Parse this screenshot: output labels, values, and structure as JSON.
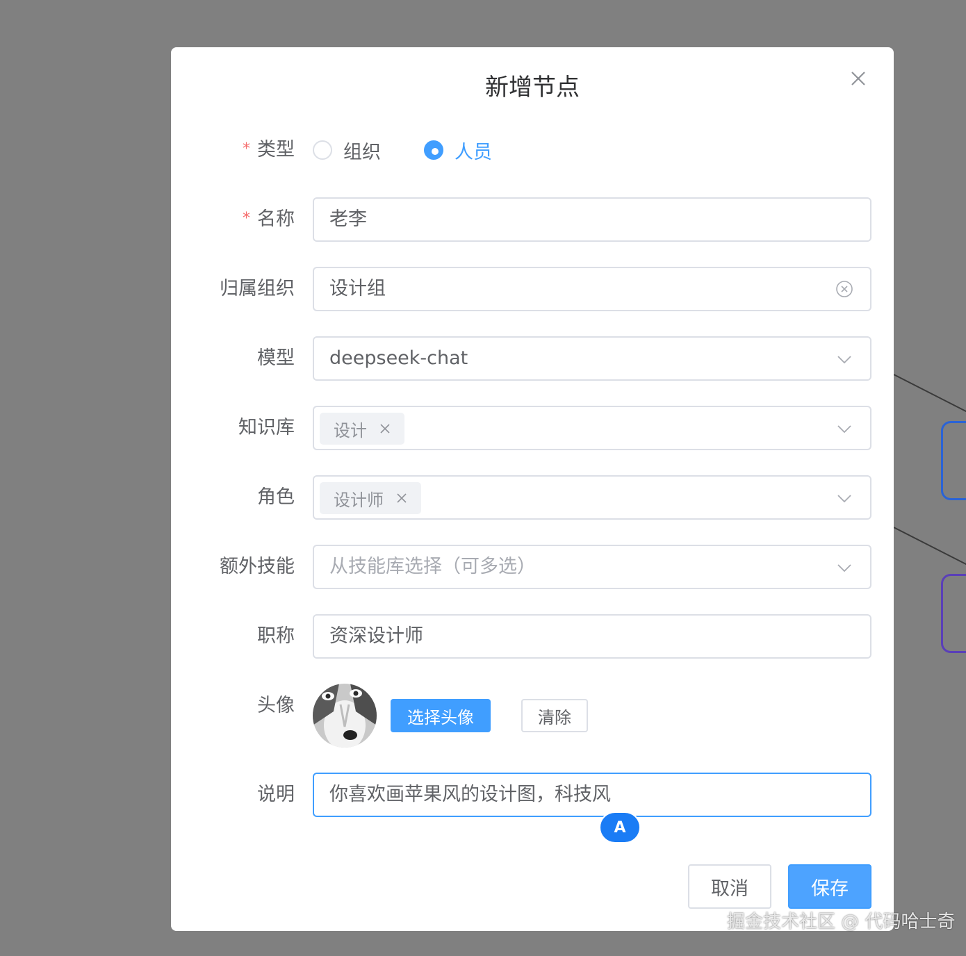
{
  "dialog": {
    "title": "新增节点"
  },
  "form": {
    "type": {
      "label": "类型",
      "required_mark": "*",
      "options": [
        "组织",
        "人员"
      ],
      "selected": "人员"
    },
    "name": {
      "label": "名称",
      "required_mark": "*",
      "value": "老李"
    },
    "org": {
      "label": "归属组织",
      "value": "设计组"
    },
    "model": {
      "label": "模型",
      "value": "deepseek-chat"
    },
    "kb": {
      "label": "知识库",
      "tags": [
        "设计"
      ]
    },
    "role": {
      "label": "角色",
      "tags": [
        "设计师"
      ]
    },
    "skills": {
      "label": "额外技能",
      "placeholder": "从技能库选择（可多选）"
    },
    "title_field": {
      "label": "职称",
      "value": "资深设计师"
    },
    "avatar": {
      "label": "头像",
      "choose_label": "选择头像",
      "clear_label": "清除"
    },
    "desc": {
      "label": "说明",
      "value": "你喜欢画苹果风的设计图，科技风"
    }
  },
  "ime_indicator": "A",
  "footer": {
    "cancel_label": "取消",
    "save_label": "保存"
  },
  "watermark": "掘金技术社区 @ 代码哈士奇",
  "colors": {
    "primary": "#409eff",
    "required": "#f56c6c",
    "overlay": "#808080"
  }
}
